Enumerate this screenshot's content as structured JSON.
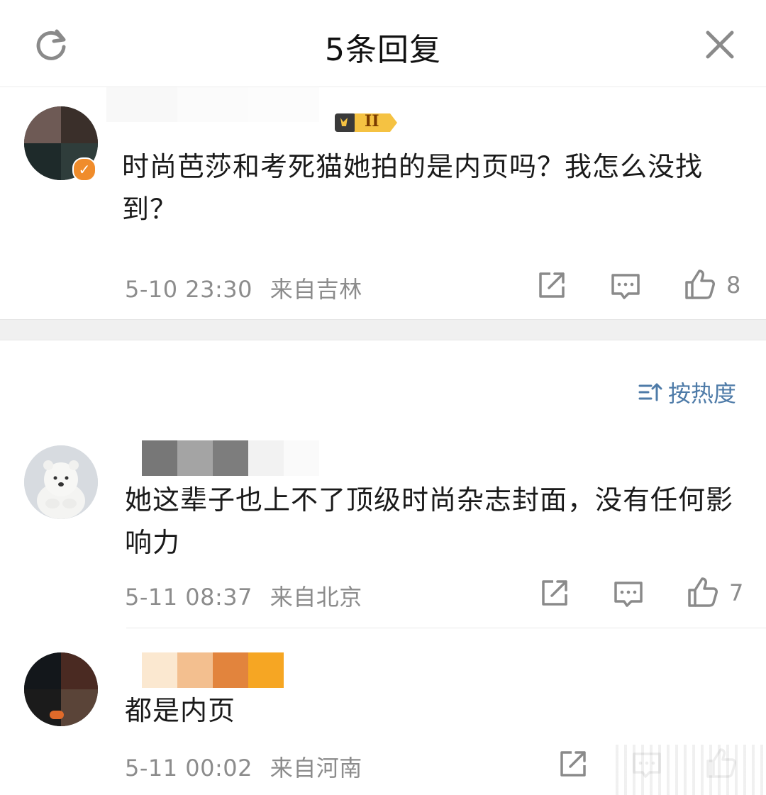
{
  "header": {
    "title": "5条回复",
    "refresh_icon": "refresh-icon",
    "close_icon": "close-icon"
  },
  "main_comment": {
    "badge_text": "II",
    "text": "时尚芭莎和考死猫她拍的是内页吗？我怎么没找到？",
    "time": "5-10 23:30",
    "location": "来自吉林",
    "likes": "8"
  },
  "sort": {
    "label": "按热度",
    "icon": "sort-icon"
  },
  "replies": [
    {
      "text": "她这辈子也上不了顶级时尚杂志封面，没有任何影响力",
      "time": "5-11 08:37",
      "location": "来自北京",
      "likes": "7"
    },
    {
      "text": "都是内页",
      "time": "5-11 00:02",
      "location": "来自河南",
      "likes": ""
    }
  ],
  "colors": {
    "accent": "#4e7ba8",
    "meta_gray": "#8c8c8c",
    "badge_gold": "#f5c242"
  }
}
